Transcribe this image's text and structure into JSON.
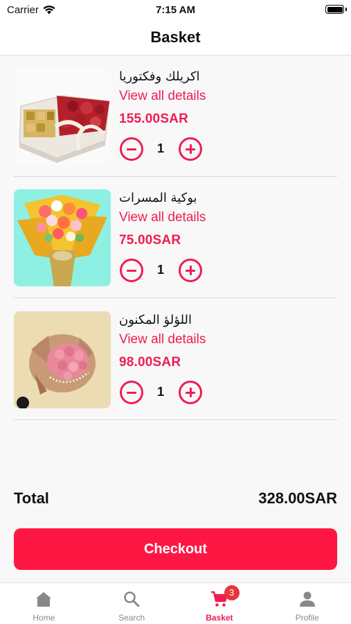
{
  "status_bar": {
    "carrier": "Carrier",
    "time": "7:15 AM"
  },
  "header": {
    "title": "Basket"
  },
  "items": [
    {
      "name": "اكريلك وفكتوريا",
      "link": "View all details",
      "price": "155.00SAR",
      "quantity": "1"
    },
    {
      "name": "بوكية المسرات",
      "link": "View all details",
      "price": "75.00SAR",
      "quantity": "1"
    },
    {
      "name": "اللؤلؤ المكنون",
      "link": "View all details",
      "price": "98.00SAR",
      "quantity": "1"
    }
  ],
  "summary": {
    "total_label": "Total",
    "total_value": "328.00SAR"
  },
  "checkout": {
    "label": "Checkout"
  },
  "tabbar": {
    "tabs": [
      {
        "label": "Home",
        "icon": "home-icon"
      },
      {
        "label": "Search",
        "icon": "search-icon"
      },
      {
        "label": "Basket",
        "icon": "cart-icon",
        "badge": "3",
        "active": true
      },
      {
        "label": "Profile",
        "icon": "person-icon"
      }
    ]
  },
  "colors": {
    "accent": "#ef1d51",
    "checkout": "#ff1744",
    "badge": "#e8353c"
  }
}
